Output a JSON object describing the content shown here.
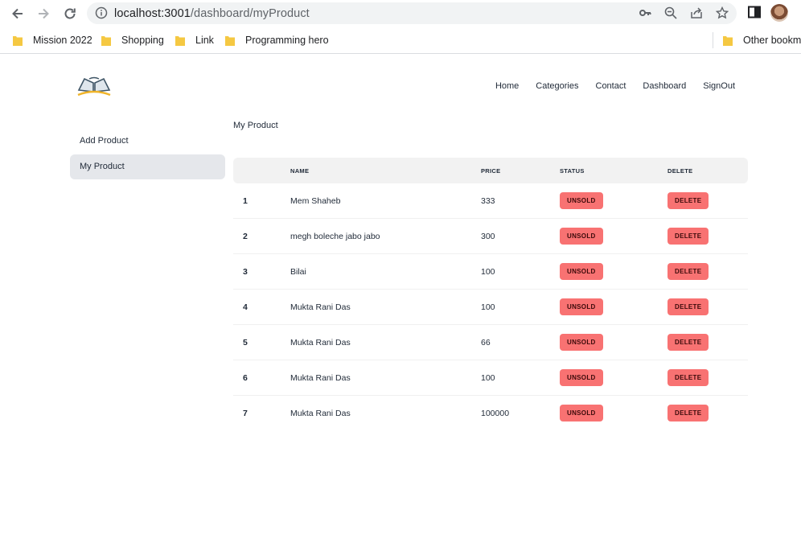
{
  "browser": {
    "url_host": "localhost:3001",
    "url_path": "/dashboard/myProduct",
    "bookmarks": [
      "Mission 2022",
      "Shopping",
      "Link",
      "Programming hero"
    ],
    "other_bookmarks": "Other bookma"
  },
  "nav": {
    "home": "Home",
    "categories": "Categories",
    "contact": "Contact",
    "dashboard": "Dashboard",
    "signout": "SignOut"
  },
  "sidebar": {
    "items": [
      {
        "label": "Add Product",
        "active": false
      },
      {
        "label": "My Product",
        "active": true
      }
    ]
  },
  "main": {
    "title": "My Product",
    "table": {
      "headers": [
        "",
        "NAME",
        "PRICE",
        "STATUS",
        "DELETE"
      ],
      "rows": [
        {
          "idx": "1",
          "name": "Mem Shaheb",
          "price": "333",
          "status": "UNSOLD",
          "action": "DELETE"
        },
        {
          "idx": "2",
          "name": "megh boleche jabo jabo",
          "price": "300",
          "status": "UNSOLD",
          "action": "DELETE"
        },
        {
          "idx": "3",
          "name": "Bilai",
          "price": "100",
          "status": "UNSOLD",
          "action": "DELETE"
        },
        {
          "idx": "4",
          "name": "Mukta Rani Das",
          "price": "100",
          "status": "UNSOLD",
          "action": "DELETE"
        },
        {
          "idx": "5",
          "name": "Mukta Rani Das",
          "price": "66",
          "status": "UNSOLD",
          "action": "DELETE"
        },
        {
          "idx": "6",
          "name": "Mukta Rani Das",
          "price": "100",
          "status": "UNSOLD",
          "action": "DELETE"
        },
        {
          "idx": "7",
          "name": "Mukta Rani Das",
          "price": "100000",
          "status": "UNSOLD",
          "action": "DELETE"
        }
      ]
    }
  },
  "colors": {
    "badge": "#f87272",
    "header_row": "#f2f2f2",
    "sidebar_active": "#e5e7eb"
  }
}
